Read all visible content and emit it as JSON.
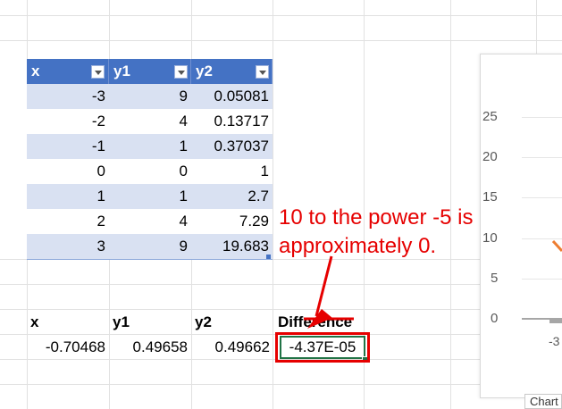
{
  "table": {
    "headers": [
      "x",
      "y1",
      "y2"
    ],
    "rows": [
      [
        "-3",
        "9",
        "0.05081"
      ],
      [
        "-2",
        "4",
        "0.13717"
      ],
      [
        "-1",
        "1",
        "0.37037"
      ],
      [
        "0",
        "0",
        "1"
      ],
      [
        "1",
        "1",
        "2.7"
      ],
      [
        "2",
        "4",
        "7.29"
      ],
      [
        "3",
        "9",
        "19.683"
      ]
    ]
  },
  "result": {
    "headers": [
      "x",
      "y1",
      "y2",
      "Difference"
    ],
    "values": [
      "-0.70468",
      "0.49658",
      "0.49662",
      "-4.37E-05"
    ]
  },
  "annotation": {
    "line1": "10 to the power -5 is",
    "line2": "approximately 0."
  },
  "chart": {
    "y_ticks": [
      "25",
      "20",
      "15",
      "10",
      "5",
      "0"
    ],
    "x_tick": "-3",
    "tab_label": "Chart",
    "series_color": "#ed7d31",
    "axis_color": "#a6a6a6"
  },
  "colors": {
    "table_header": "#4472c4",
    "band": "#d9e1f2",
    "annotation": "#e60000",
    "selection": "#217346"
  }
}
